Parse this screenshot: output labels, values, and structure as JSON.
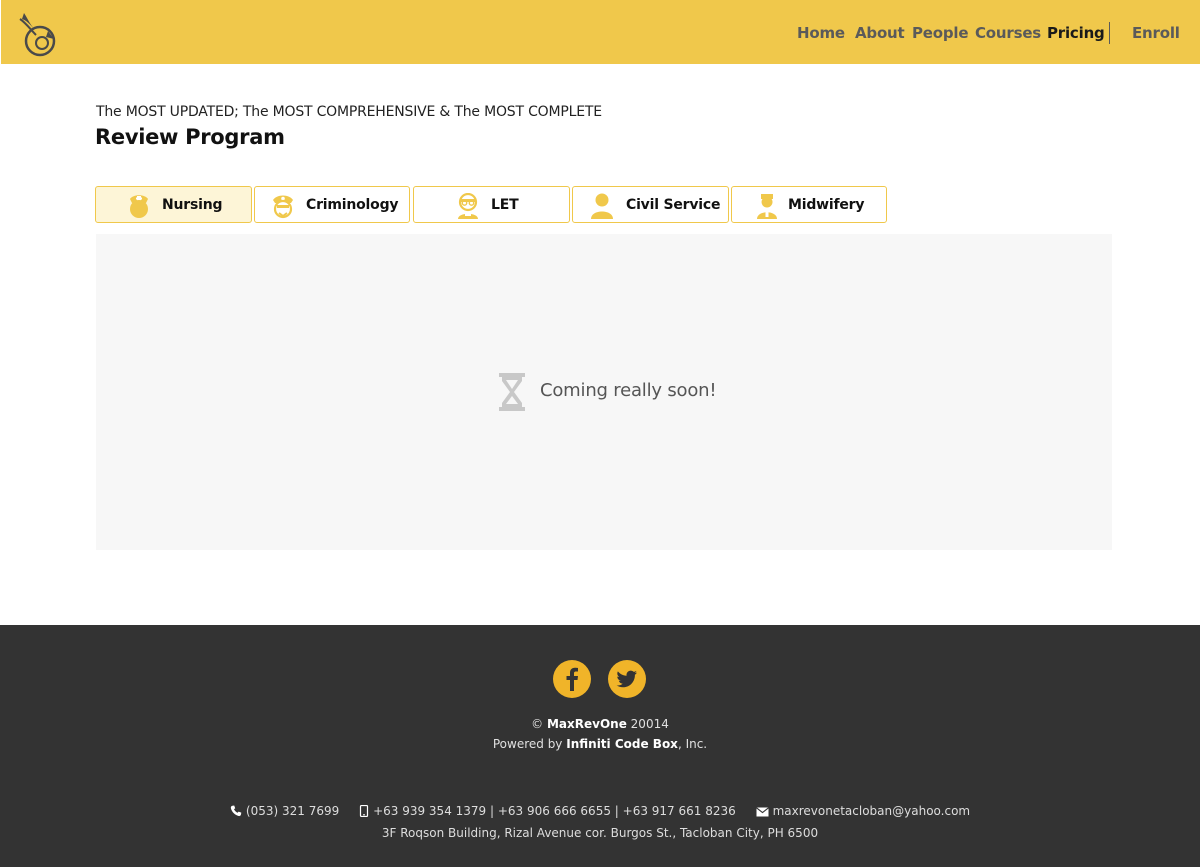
{
  "header": {
    "logo_icon": "bird-emblem-logo",
    "nav": [
      "Home",
      "About",
      "People",
      "Courses",
      "Pricing",
      "Enroll"
    ],
    "active_nav": "Pricing",
    "accent_color": "#f0c84b"
  },
  "hero": {
    "tagline": "The MOST UPDATED; The MOST COMPREHENSIVE & The MOST COMPLETE",
    "title": "Review Program"
  },
  "tabs": [
    {
      "label": "Nursing",
      "icon": "nurse-cap-icon",
      "active": true
    },
    {
      "label": "Criminology",
      "icon": "police-officer-icon",
      "active": false
    },
    {
      "label": "LET",
      "icon": "teacher-icon",
      "active": false
    },
    {
      "label": "Civil Service",
      "icon": "person-icon",
      "active": false
    },
    {
      "label": "Midwifery",
      "icon": "midwife-icon",
      "active": false
    }
  ],
  "panel": {
    "icon": "hourglass-icon",
    "message": "Coming really soon!"
  },
  "footer": {
    "social": [
      "facebook-icon",
      "twitter-icon"
    ],
    "copyright_symbol": "©",
    "brand": "MaxRevOne",
    "year": "20014",
    "powered_prefix": "Powered by",
    "powered_company": "Infiniti Code Box",
    "powered_suffix": ", Inc.",
    "phone": "(053) 321 7699",
    "mobile": "+63 939 354 1379 | +63 906 666 6655 | +63 917 661 8236",
    "email": "maxrevonetacloban@yahoo.com",
    "address": "3F Roqson Building, Rizal Avenue cor. Burgos St., Tacloban City, PH 6500"
  }
}
